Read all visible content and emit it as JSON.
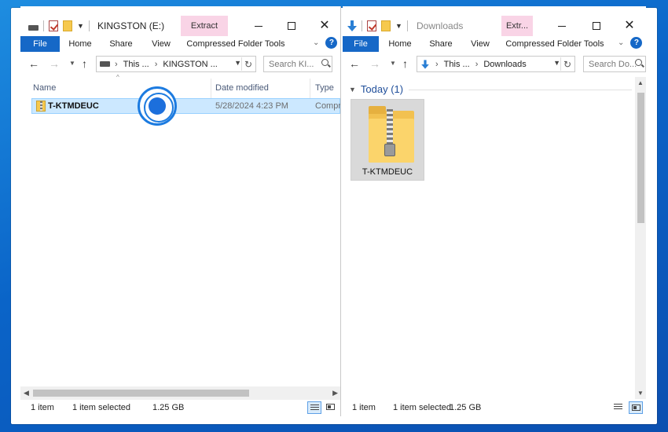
{
  "left_window": {
    "title": "KINGSTON (E:)",
    "contextual_tab": "Extract",
    "ribbon": {
      "file": "File",
      "home": "Home",
      "share": "Share",
      "view": "View",
      "tools": "Compressed Folder Tools"
    },
    "address": {
      "part1": "This ...",
      "part2": "KINGSTON ..."
    },
    "search_placeholder": "Search KI...",
    "columns": {
      "name": "Name",
      "date": "Date modified",
      "type": "Type"
    },
    "rows": [
      {
        "name": "T-KTMDEUC",
        "date": "5/28/2024 4:23 PM",
        "type": "Compr"
      }
    ],
    "status": {
      "count": "1 item",
      "selected": "1 item selected",
      "size": "1.25 GB"
    }
  },
  "right_window": {
    "title": "Downloads",
    "contextual_tab": "Extr...",
    "ribbon": {
      "file": "File",
      "home": "Home",
      "share": "Share",
      "view": "View",
      "tools": "Compressed Folder Tools"
    },
    "address": {
      "part1": "This ...",
      "part2": "Downloads"
    },
    "search_placeholder": "Search Do...",
    "group_label": "Today (1)",
    "items": [
      {
        "name": "T-KTMDEUC"
      }
    ],
    "status": {
      "count": "1 item",
      "selected": "1 item selected",
      "size": "1.25 GB"
    }
  },
  "icons": {
    "back": "←",
    "forward": "→",
    "up": "↑",
    "refresh": "↻",
    "help": "?",
    "close": "✕",
    "chevron_down": "⌄",
    "sort_up": "^"
  },
  "colors": {
    "accent": "#1668c7",
    "selection": "#cce8ff",
    "extract_tab": "#f9d4e6",
    "group_text": "#1f4e9a"
  }
}
